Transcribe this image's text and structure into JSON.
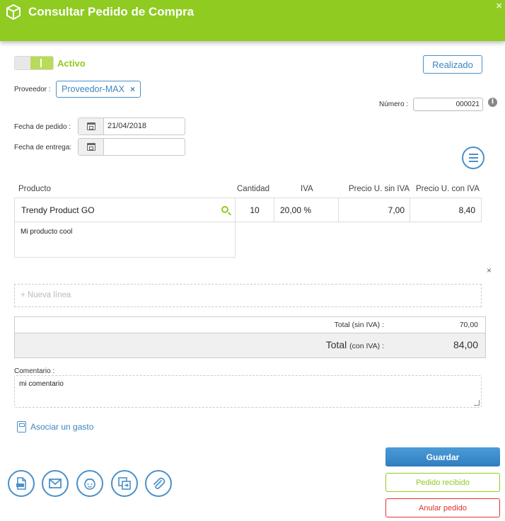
{
  "header": {
    "title": "Consultar Pedido de Compra",
    "close_label": "×"
  },
  "status": {
    "toggle_label": "Activo",
    "realizado_label": "Realizado"
  },
  "supplier": {
    "label": "Proveedor :",
    "value": "Proveedor-MAX",
    "remove_label": "×"
  },
  "numero": {
    "label": "Número :",
    "value": "000021"
  },
  "dates": {
    "order_label": "Fecha de pedido :",
    "order_value": "21/04/2018",
    "delivery_label": "Fecha de entrega:",
    "delivery_value": ""
  },
  "table": {
    "columns": [
      "Producto",
      "Cantidad",
      "IVA",
      "Precio U. sin IVA",
      "Precio U. con IVA"
    ],
    "rows": [
      {
        "product": "Trendy Product GO",
        "description": "Mi producto cool",
        "quantity": "10",
        "iva": "20,00 %",
        "price_no_tax": "7,00",
        "price_tax": "8,40"
      }
    ],
    "remove_row_label": "×",
    "new_line_label": "+ Nueva línea"
  },
  "totals": {
    "subtotal_label": "Total (sin IVA) :",
    "subtotal_value": "70,00",
    "total_label": "Total",
    "total_suffix": "(con IVA) :",
    "total_value": "84,00"
  },
  "comment": {
    "label": "Comentario :",
    "value": "mi comentario"
  },
  "links": {
    "asociar_label": "Asociar un gasto"
  },
  "actions": {
    "guardar_label": "Guardar",
    "recibido_label": "Pedido recibido",
    "anular_label": "Anular pedido"
  },
  "colors": {
    "brand_green": "#8fcb21",
    "accent_blue": "#4a90c8",
    "danger_red": "#e03030"
  }
}
